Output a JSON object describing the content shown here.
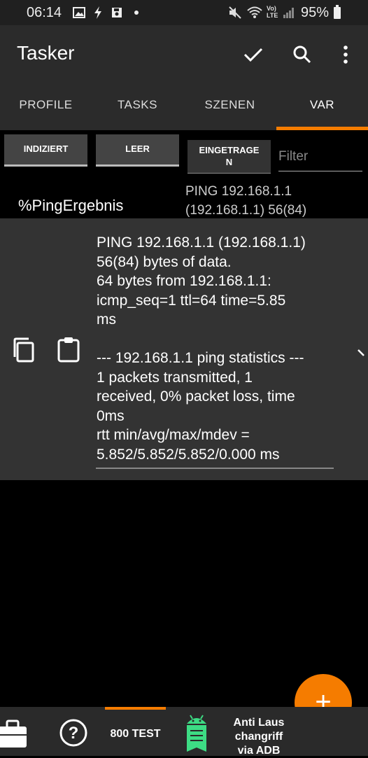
{
  "status_bar": {
    "time": "06:14",
    "left_icons": [
      "image-icon",
      "flash-icon",
      "save-icon",
      "dot-icon"
    ],
    "right_icons": [
      "mute-icon",
      "wifi-icon",
      "volte-icon",
      "signal-icon"
    ],
    "right_text": "Vo) LTE",
    "battery": "95%"
  },
  "app_bar": {
    "title": "Tasker",
    "actions": [
      "check-icon",
      "search-icon",
      "more-vert-icon"
    ]
  },
  "tabs": [
    {
      "label": "PROFILE",
      "active": false
    },
    {
      "label": "TASKS",
      "active": false
    },
    {
      "label": "SZENEN",
      "active": false
    },
    {
      "label": "VAR",
      "active": true
    }
  ],
  "filters": {
    "indexed": "INDIZIERT",
    "empty": "LEER",
    "entered_line1": "EINGETRAGE",
    "entered_line2": "N",
    "filter_placeholder": "Filter"
  },
  "variable": {
    "name": "%PingErgebnis",
    "preview": "PING 192.168.1.1\n(192.168.1.1) 56(84)",
    "value": "PING 192.168.1.1 (192.168.1.1)\n56(84) bytes of data.\n64 bytes from 192.168.1.1:\nicmp_seq=1 ttl=64 time=5.85\nms\n\n--- 192.168.1.1 ping statistics ---\n1 packets transmitted, 1\nreceived, 0% packet loss, time\n0ms\nrtt min/avg/max/mdev =\n5.852/5.852/5.852/0.000 ms"
  },
  "fab": {
    "icon": "add-icon",
    "label": "+"
  },
  "bottom_bar": {
    "items": [
      {
        "icon": "briefcase-icon"
      },
      {
        "icon": "help-icon",
        "glyph": "?"
      },
      {
        "label": "800 TEST",
        "active": true
      },
      {
        "icon": "android-notes-icon"
      },
      {
        "label_line1": "Anti Laus",
        "label_line2": "changriff",
        "label_line3": "via ADB"
      }
    ]
  },
  "colors": {
    "accent": "#f57c00",
    "app_bar": "#2b2b2b",
    "popup": "#333333",
    "android_green": "#3ddc84"
  }
}
